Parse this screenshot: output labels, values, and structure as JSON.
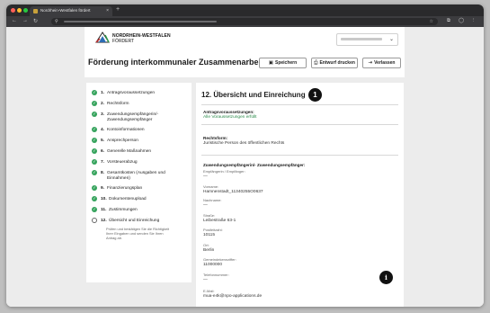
{
  "browser": {
    "tab_title": "Nordrhein-Westfalen fördert",
    "tab_close": "×",
    "new_tab": "+",
    "nav": {
      "back": "←",
      "forward": "→",
      "reload": "↻"
    }
  },
  "header": {
    "logo_line1": "NORDRHEIN-WESTFALEN",
    "logo_line2": "FÖRDERT",
    "user_chevron": "⌄",
    "page_title": "Förderung interkommunaler Zusammenarbei...",
    "buttons": {
      "save": {
        "icon": "save-icon",
        "label": "Speichern"
      },
      "print": {
        "icon": "printer-icon",
        "label": "Entwurf drucken"
      },
      "leave": {
        "icon": "exit-icon",
        "label": "Verlassen"
      }
    }
  },
  "sidebar": {
    "steps": [
      {
        "num": "1.",
        "label": "Antragsvoraussetzungen",
        "done": true
      },
      {
        "num": "2.",
        "label": "Rechtsform",
        "done": true
      },
      {
        "num": "3.",
        "label": "Zuwendungsempfängerin/-",
        "label2": "Zuwendungsempfänger",
        "done": true
      },
      {
        "num": "4.",
        "label": "Kontoinformationen",
        "done": true
      },
      {
        "num": "5.",
        "label": "Ansprechperson",
        "done": true
      },
      {
        "num": "6.",
        "label": "Generelle Maßnahmen",
        "done": true
      },
      {
        "num": "7.",
        "label": "Vorsteuerabzug",
        "done": true
      },
      {
        "num": "8.",
        "label": "Gesamtkosten (Ausgaben und",
        "label2": "Einnahmen)",
        "done": true
      },
      {
        "num": "9.",
        "label": "Finanzierungsplan",
        "done": true
      },
      {
        "num": "10.",
        "label": "Dokumentenupload",
        "done": true
      },
      {
        "num": "11.",
        "label": "Zustimmungen",
        "done": true
      },
      {
        "num": "12.",
        "label": "Übersicht und Einreichung",
        "done": false
      }
    ],
    "current_desc1": "Prüfen und bestätigen Sie die Richtigkeit",
    "current_desc2": "Ihrer Eingaben und senden Sie Ihren",
    "current_desc3": "Antrag ab."
  },
  "main": {
    "title": "12. Übersicht und Einreichung",
    "badge": "1",
    "sections": {
      "antrag_label": "Antragsvoraussetzungen:",
      "antrag_value": "Alle Voraussetzungen erfüllt",
      "rechtsform_label": "Rechtsform:",
      "rechtsform_value": "Juristische Person des öffentlichen Rechts",
      "zuw_label": "Zuwendungsempfängerin/- Zuwendungsempfänger:",
      "zuw_sub": "Empfängerin / Empfänger:",
      "zuw_sub_value": "—",
      "vorname_label": "Vorname:",
      "vorname_value": "Hamnenstadt_11340255O0637",
      "nachname_label": "Nachname:",
      "nachname_value": "—",
      "strasse_label": "Straße:",
      "strasse_value": "Leibestraße 63-1",
      "plz_label": "Postleitzahl:",
      "plz_value": "10115",
      "ort_label": "Ort:",
      "ort_value": "Berlin",
      "gkz_label": "Gemeindekennziffer:",
      "gkz_value": "11000000",
      "tel_label": "Telefonnummer:",
      "tel_value": "—",
      "email_label": "E-Mail:",
      "email_value": "mua-e4k@npo-applications.de"
    },
    "info_icon": "i"
  },
  "colors": {
    "check": "#35a35c",
    "link_green": "#2a8a4a",
    "badge": "#111111"
  }
}
